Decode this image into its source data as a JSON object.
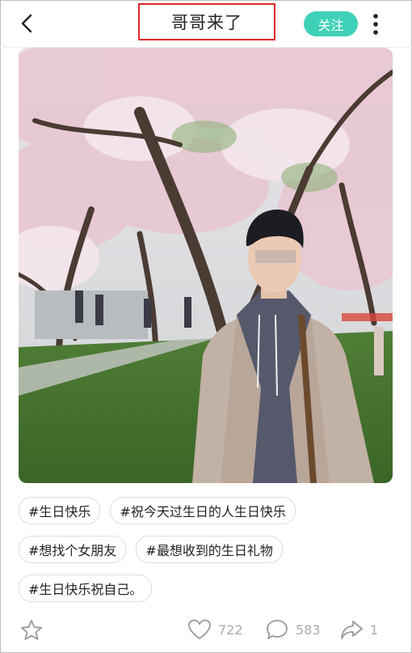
{
  "header": {
    "title": "哥哥来了",
    "follow_label": "关注"
  },
  "tags": [
    [
      "#生日快乐",
      "#祝今天过生日的人生日快乐"
    ],
    [
      "#想找个女朋友",
      "#最想收到的生日礼物"
    ],
    [
      "#生日快乐祝自己。"
    ]
  ],
  "footer": {
    "likes": "722",
    "comments": "583",
    "shares": "1"
  },
  "colors": {
    "accent": "#3fd1b7",
    "title_highlight": "#e0292b"
  }
}
